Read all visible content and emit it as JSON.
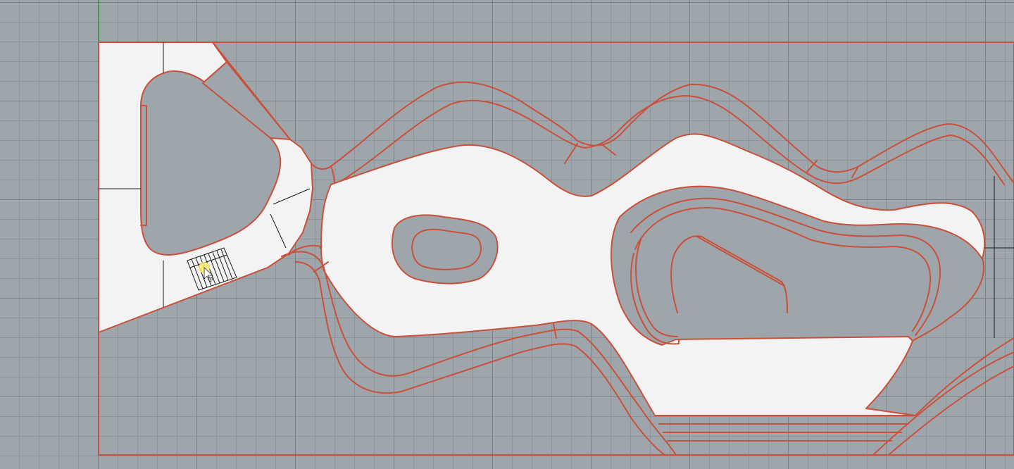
{
  "viewport": {
    "name": "top-view-viewport",
    "background_color": "#9fa6ab",
    "grid_color": "#7e868b",
    "curve_color": "#c9503a",
    "surface_color": "#f3f3f3"
  },
  "annotations": {
    "stair_dimension": "15"
  },
  "cursor": {
    "icon": "arrow-cursor-icon"
  }
}
